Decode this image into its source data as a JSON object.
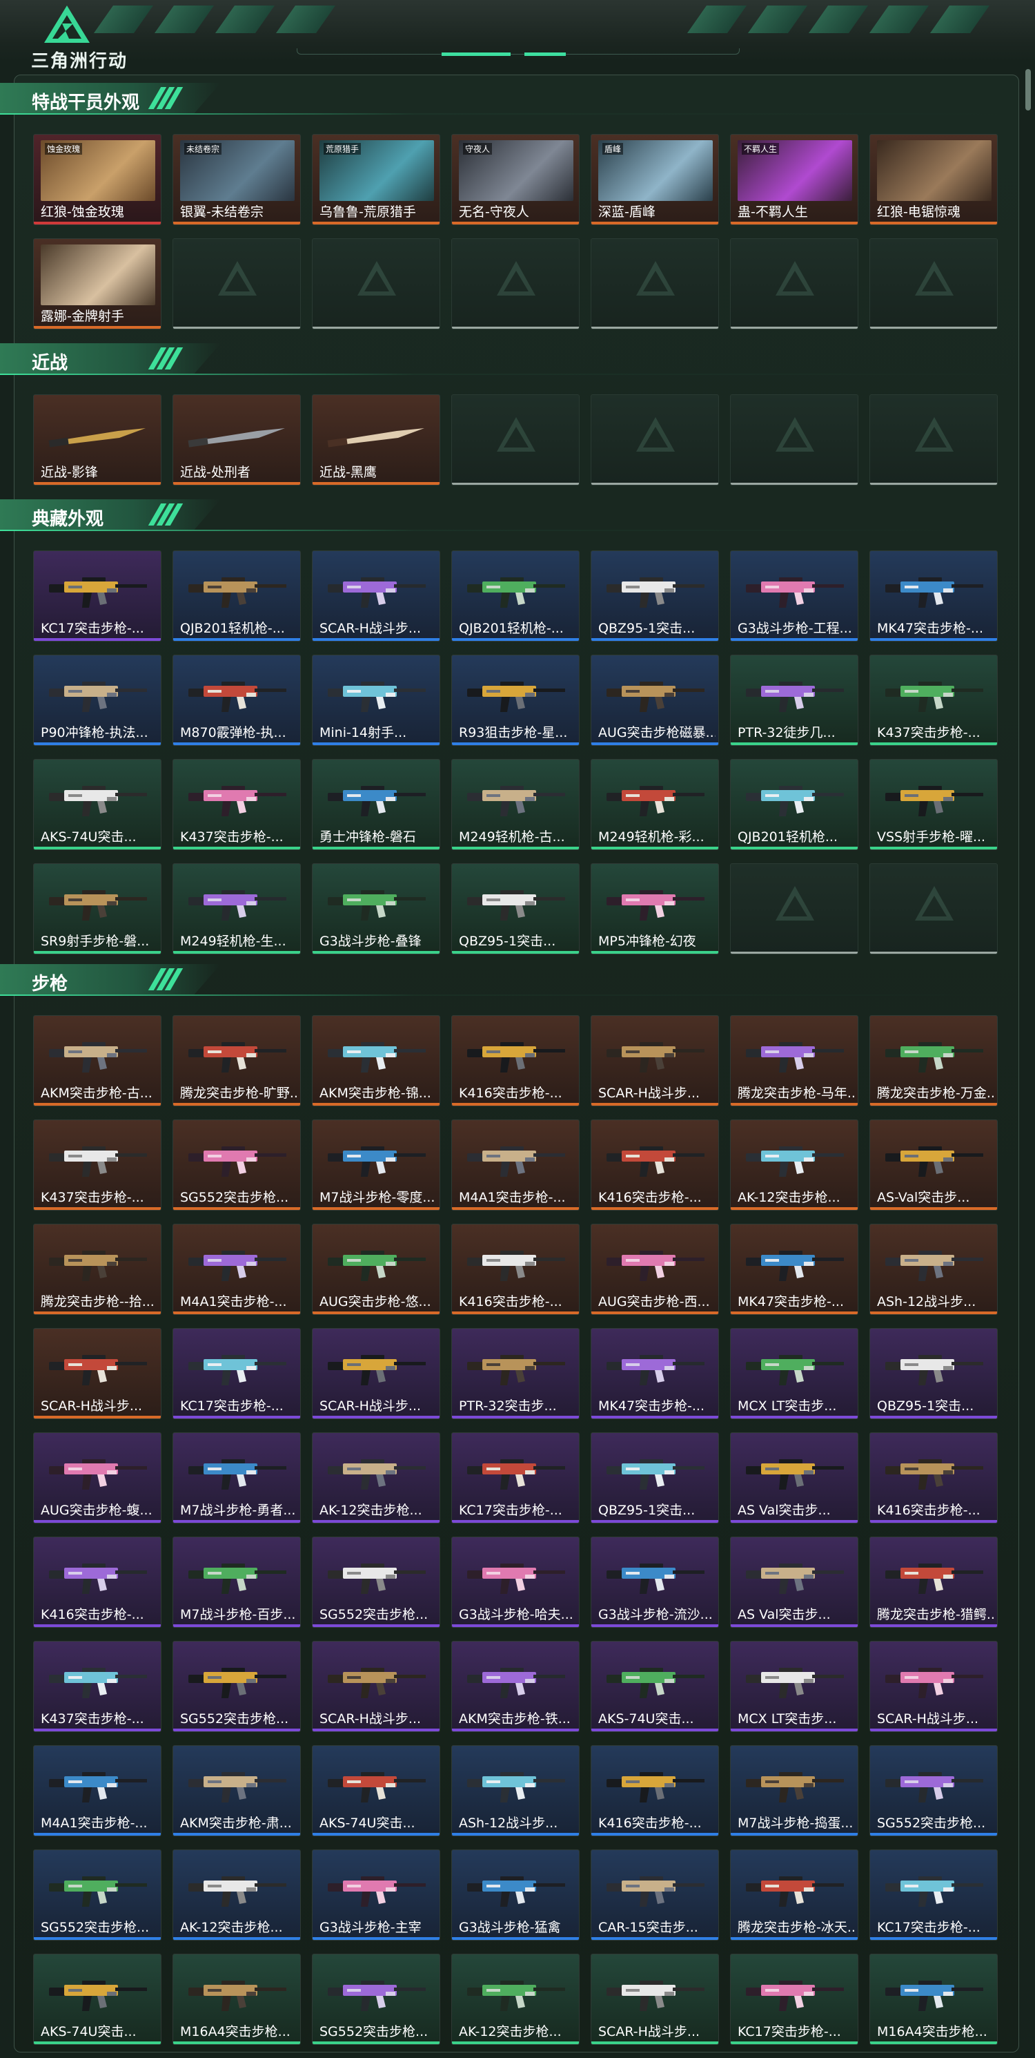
{
  "app": {
    "logo_text": "三角洲行动"
  },
  "sections": [
    {
      "id": "operators",
      "title": "特战干员外观",
      "items": [
        {
          "label": "红狼-蚀金玫瑰",
          "rarity": "red",
          "tag": "蚀金玫瑰"
        },
        {
          "label": "银翼-未结卷宗",
          "rarity": "orange",
          "tag": "未结卷宗"
        },
        {
          "label": "乌鲁鲁-荒原猎手",
          "rarity": "orange",
          "tag": "荒原猎手"
        },
        {
          "label": "无名-守夜人",
          "rarity": "orange",
          "tag": "守夜人"
        },
        {
          "label": "深蓝-盾峰",
          "rarity": "orange",
          "tag": "盾峰"
        },
        {
          "label": "蛊-不羁人生",
          "rarity": "orange",
          "tag": "不羁人生"
        },
        {
          "label": "红狼-电锯惊魂",
          "rarity": "orange",
          "tag": ""
        },
        {
          "label": "露娜-金牌射手",
          "rarity": "orange",
          "tag": ""
        }
      ],
      "empty_count": 6
    },
    {
      "id": "melee",
      "title": "近战",
      "items": [
        {
          "label": "近战-影锋",
          "rarity": "orange"
        },
        {
          "label": "近战-处刑者",
          "rarity": "orange"
        },
        {
          "label": "近战-黑鹰",
          "rarity": "orange"
        }
      ],
      "empty_count": 4
    },
    {
      "id": "collection",
      "title": "典藏外观",
      "items": [
        {
          "label": "KC17突击步枪-...",
          "rarity": "purple"
        },
        {
          "label": "QJB201轻机枪-...",
          "rarity": "blue"
        },
        {
          "label": "SCAR-H战斗步...",
          "rarity": "blue"
        },
        {
          "label": "QJB201轻机枪-...",
          "rarity": "blue"
        },
        {
          "label": "QBZ95-1突击...",
          "rarity": "blue"
        },
        {
          "label": "G3战斗步枪-工程...",
          "rarity": "blue"
        },
        {
          "label": "MK47突击步枪-...",
          "rarity": "blue"
        },
        {
          "label": "P90冲锋枪-执法...",
          "rarity": "blue"
        },
        {
          "label": "M870霰弹枪-执...",
          "rarity": "blue"
        },
        {
          "label": "Mini-14射手...",
          "rarity": "blue"
        },
        {
          "label": "R93狙击步枪-星...",
          "rarity": "blue"
        },
        {
          "label": "AUG突击步枪磁暴...",
          "rarity": "blue"
        },
        {
          "label": "PTR-32徒步几...",
          "rarity": "green"
        },
        {
          "label": "K437突击步枪-...",
          "rarity": "green"
        },
        {
          "label": "AKS-74U突击...",
          "rarity": "green"
        },
        {
          "label": "K437突击步枪-...",
          "rarity": "green"
        },
        {
          "label": "勇士冲锋枪-磐石",
          "rarity": "green"
        },
        {
          "label": "M249轻机枪-古...",
          "rarity": "green"
        },
        {
          "label": "M249轻机枪-彩...",
          "rarity": "green"
        },
        {
          "label": "QJB201轻机枪...",
          "rarity": "green"
        },
        {
          "label": "VSS射手步枪-曜...",
          "rarity": "green"
        },
        {
          "label": "SR9射手步枪-磐...",
          "rarity": "green"
        },
        {
          "label": "M249轻机枪-生...",
          "rarity": "green"
        },
        {
          "label": "G3战斗步枪-叠锋",
          "rarity": "green"
        },
        {
          "label": "QBZ95-1突击...",
          "rarity": "green"
        },
        {
          "label": "MP5冲锋枪-幻夜",
          "rarity": "green"
        }
      ],
      "empty_count": 2
    },
    {
      "id": "rifles",
      "title": "步枪",
      "items": [
        {
          "label": "AKM突击步枪-古...",
          "rarity": "orange"
        },
        {
          "label": "腾龙突击步枪-旷野...",
          "rarity": "orange"
        },
        {
          "label": "AKM突击步枪-锦...",
          "rarity": "orange"
        },
        {
          "label": "K416突击步枪-...",
          "rarity": "orange"
        },
        {
          "label": "SCAR-H战斗步...",
          "rarity": "orange"
        },
        {
          "label": "腾龙突击步枪-马年...",
          "rarity": "orange"
        },
        {
          "label": "腾龙突击步枪-万金...",
          "rarity": "orange"
        },
        {
          "label": "K437突击步枪-...",
          "rarity": "orange"
        },
        {
          "label": "SG552突击步枪...",
          "rarity": "orange"
        },
        {
          "label": "M7战斗步枪-零度...",
          "rarity": "orange"
        },
        {
          "label": "M4A1突击步枪-...",
          "rarity": "orange"
        },
        {
          "label": "K416突击步枪-...",
          "rarity": "orange"
        },
        {
          "label": "AK-12突击步枪...",
          "rarity": "orange"
        },
        {
          "label": "AS-Val突击步...",
          "rarity": "orange"
        },
        {
          "label": "腾龙突击步枪--拾...",
          "rarity": "orange"
        },
        {
          "label": "M4A1突击步枪-...",
          "rarity": "orange"
        },
        {
          "label": "AUG突击步枪-悠...",
          "rarity": "orange"
        },
        {
          "label": "K416突击步枪-...",
          "rarity": "orange"
        },
        {
          "label": "AUG突击步枪-西...",
          "rarity": "orange"
        },
        {
          "label": "MK47突击步枪-...",
          "rarity": "orange"
        },
        {
          "label": "ASh-12战斗步...",
          "rarity": "orange"
        },
        {
          "label": "SCAR-H战斗步...",
          "rarity": "orange"
        },
        {
          "label": "KC17突击步枪-...",
          "rarity": "purple"
        },
        {
          "label": "SCAR-H战斗步...",
          "rarity": "purple"
        },
        {
          "label": "PTR-32突击步...",
          "rarity": "purple"
        },
        {
          "label": "MK47突击步枪-...",
          "rarity": "purple"
        },
        {
          "label": "MCX LT突击步...",
          "rarity": "purple"
        },
        {
          "label": "QBZ95-1突击...",
          "rarity": "purple"
        },
        {
          "label": "AUG突击步枪-蝮...",
          "rarity": "purple"
        },
        {
          "label": "M7战斗步枪-勇者...",
          "rarity": "purple"
        },
        {
          "label": "AK-12突击步枪...",
          "rarity": "purple"
        },
        {
          "label": "KC17突击步枪-...",
          "rarity": "purple"
        },
        {
          "label": "QBZ95-1突击...",
          "rarity": "purple"
        },
        {
          "label": "AS Val突击步...",
          "rarity": "purple"
        },
        {
          "label": "K416突击步枪-...",
          "rarity": "purple"
        },
        {
          "label": "K416突击步枪-...",
          "rarity": "purple"
        },
        {
          "label": "M7战斗步枪-百步...",
          "rarity": "purple"
        },
        {
          "label": "SG552突击步枪...",
          "rarity": "purple"
        },
        {
          "label": "G3战斗步枪-哈夫...",
          "rarity": "purple"
        },
        {
          "label": "G3战斗步枪-流沙...",
          "rarity": "purple"
        },
        {
          "label": "AS Val突击步...",
          "rarity": "purple"
        },
        {
          "label": "腾龙突击步枪-猎鳄...",
          "rarity": "purple"
        },
        {
          "label": "K437突击步枪-...",
          "rarity": "purple"
        },
        {
          "label": "SG552突击步枪...",
          "rarity": "purple"
        },
        {
          "label": "SCAR-H战斗步...",
          "rarity": "purple"
        },
        {
          "label": "AKM突击步枪-铁...",
          "rarity": "purple"
        },
        {
          "label": "AKS-74U突击...",
          "rarity": "purple"
        },
        {
          "label": "MCX LT突击步...",
          "rarity": "purple"
        },
        {
          "label": "SCAR-H战斗步...",
          "rarity": "purple"
        },
        {
          "label": "M4A1突击步枪-...",
          "rarity": "blue"
        },
        {
          "label": "AKM突击步枪-肃...",
          "rarity": "blue"
        },
        {
          "label": "AKS-74U突击...",
          "rarity": "blue"
        },
        {
          "label": "ASh-12战斗步...",
          "rarity": "blue"
        },
        {
          "label": "K416突击步枪-...",
          "rarity": "blue"
        },
        {
          "label": "M7战斗步枪-捣蛋...",
          "rarity": "blue"
        },
        {
          "label": "SG552突击步枪...",
          "rarity": "blue"
        },
        {
          "label": "SG552突击步枪...",
          "rarity": "blue"
        },
        {
          "label": "AK-12突击步枪...",
          "rarity": "blue"
        },
        {
          "label": "G3战斗步枪-主宰",
          "rarity": "blue"
        },
        {
          "label": "G3战斗步枪-猛禽",
          "rarity": "blue"
        },
        {
          "label": "CAR-15突击步...",
          "rarity": "blue"
        },
        {
          "label": "腾龙突击步枪-冰天...",
          "rarity": "blue"
        },
        {
          "label": "KC17突击步枪-...",
          "rarity": "blue"
        },
        {
          "label": "AKS-74U突击...",
          "rarity": "green"
        },
        {
          "label": "M16A4突击步枪...",
          "rarity": "green"
        },
        {
          "label": "SG552突击步枪...",
          "rarity": "green"
        },
        {
          "label": "AK-12突击步枪...",
          "rarity": "green"
        },
        {
          "label": "SCAR-H战斗步...",
          "rarity": "green"
        },
        {
          "label": "KC17突击步枪-...",
          "rarity": "green"
        },
        {
          "label": "M16A4突击步枪...",
          "rarity": "green"
        }
      ],
      "empty_count": 0
    }
  ],
  "colors": {
    "accent": "#3ee09a",
    "orange": "#d86a28",
    "purple": "#7c4ad8",
    "blue": "#2f7fe6",
    "green": "#3ad28a",
    "red": "#d03a3a"
  }
}
